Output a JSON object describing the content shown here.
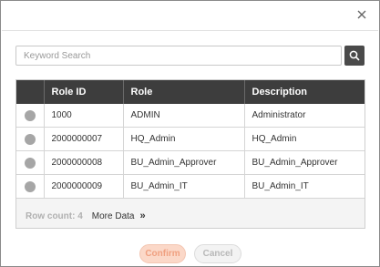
{
  "dialog": {
    "close_icon": "close-icon"
  },
  "search": {
    "placeholder": "Keyword Search",
    "value": "",
    "button_icon": "search-icon"
  },
  "table": {
    "columns": [
      "Role ID",
      "Role",
      "Description"
    ],
    "rows": [
      {
        "role_id": "1000",
        "role": "ADMIN",
        "description": "Administrator"
      },
      {
        "role_id": "2000000007",
        "role": "HQ_Admin",
        "description": "HQ_Admin"
      },
      {
        "role_id": "2000000008",
        "role": "BU_Admin_Approver",
        "description": "BU_Admin_Approver"
      },
      {
        "role_id": "2000000009",
        "role": "BU_Admin_IT",
        "description": "BU_Admin_IT"
      }
    ]
  },
  "footer": {
    "row_count": "Row count: 4",
    "more_data": "More Data",
    "more_icon": "double-chevron-right-icon"
  },
  "actions": {
    "confirm": "Confirm",
    "cancel": "Cancel"
  },
  "colors": {
    "header_bg": "#3d3d3d",
    "confirm_bg": "#fbd8c8",
    "confirm_text": "#f0a080",
    "radio": "#a6a6a6"
  }
}
